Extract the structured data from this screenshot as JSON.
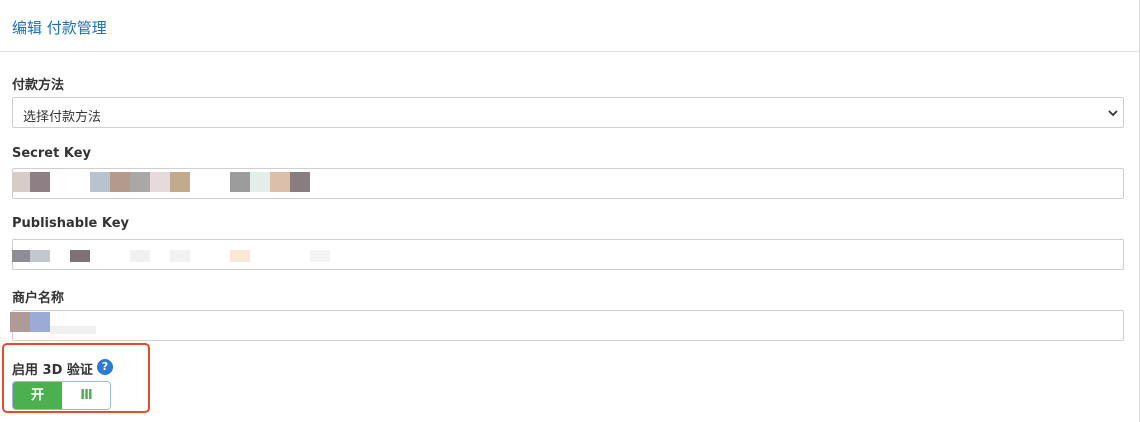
{
  "header": {
    "title": "编辑 付款管理"
  },
  "form": {
    "payment_method": {
      "label": "付款方法",
      "value": "选择付款方法"
    },
    "secret_key": {
      "label": "Secret Key"
    },
    "publishable_key": {
      "label": "Publishable Key"
    },
    "merchant_name": {
      "label": "商户名称"
    },
    "enable_3d": {
      "label": "启用 3D 验证",
      "help": "?",
      "toggle_on": "开",
      "toggle_handle": "III"
    }
  },
  "colors": {
    "title": "#1e6fb8",
    "toggle_on": "#4caf50",
    "highlight": "#e84a2a",
    "help_icon": "#2b7bd4"
  }
}
